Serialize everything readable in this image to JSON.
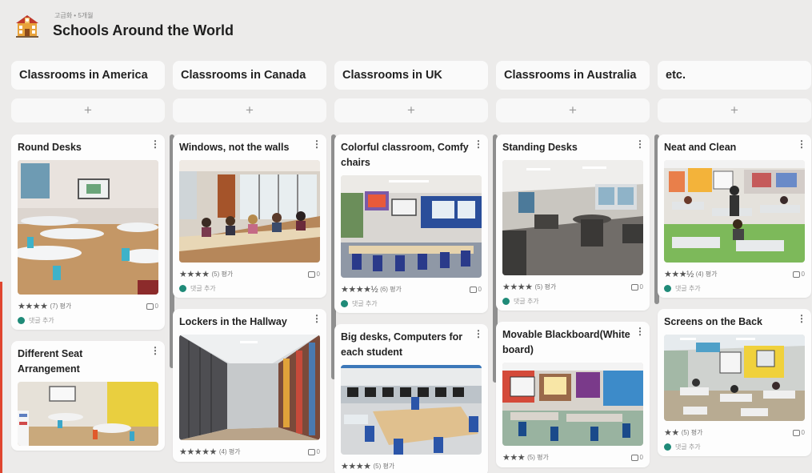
{
  "header": {
    "breadcrumb": "고급화 • 5개월",
    "title": "Schools Around the World",
    "logo_icon": "school-building-icon"
  },
  "add_label": "+",
  "columns": [
    {
      "title": "Classrooms in America",
      "cards": [
        {
          "title": "Round Desks",
          "stars": "★★★★",
          "rating": "(7) 평가",
          "comments": "0",
          "comment_prompt": "댓글 추가"
        },
        {
          "title": "Different Seat Arrangement"
        }
      ]
    },
    {
      "title": "Classrooms in Canada",
      "cards": [
        {
          "title": "Windows, not the walls",
          "stars": "★★★★",
          "rating": "(5) 평가",
          "comments": "0",
          "comment_prompt": "댓글 추가"
        },
        {
          "title": "Lockers in the Hallway",
          "stars": "★★★★★",
          "rating": "(4) 평가",
          "comments": "0"
        }
      ]
    },
    {
      "title": "Classrooms in UK",
      "cards": [
        {
          "title": "Colorful classroom, Comfy chairs",
          "stars": "★★★★½",
          "rating": "(6) 평가",
          "comments": "0",
          "comment_prompt": "댓글 추가"
        },
        {
          "title": "Big desks, Computers for each student",
          "stars": "★★★★",
          "rating": "(5) 평가"
        }
      ]
    },
    {
      "title": "Classrooms in Australia",
      "cards": [
        {
          "title": "Standing Desks",
          "stars": "★★★★",
          "rating": "(5) 평가",
          "comments": "0",
          "comment_prompt": "댓글 추가"
        },
        {
          "title": "Movable Blackboard(White board)",
          "stars": "★★★",
          "rating": "(5) 평가",
          "comments": "0"
        }
      ]
    },
    {
      "title": "etc.",
      "cards": [
        {
          "title": "Neat and Clean",
          "stars": "★★★½",
          "rating": "(4) 평가",
          "comments": "0",
          "comment_prompt": "댓글 추가"
        },
        {
          "title": "Screens on the Back",
          "stars": "★★",
          "rating": "(5) 평가",
          "comments": "0",
          "comment_prompt": "댓글 추가"
        }
      ]
    }
  ],
  "colors": {
    "background": "#ecebea",
    "card": "#fdfdfd",
    "comment_dot": "#1f8a78",
    "edge_accent": "#e0452f"
  }
}
